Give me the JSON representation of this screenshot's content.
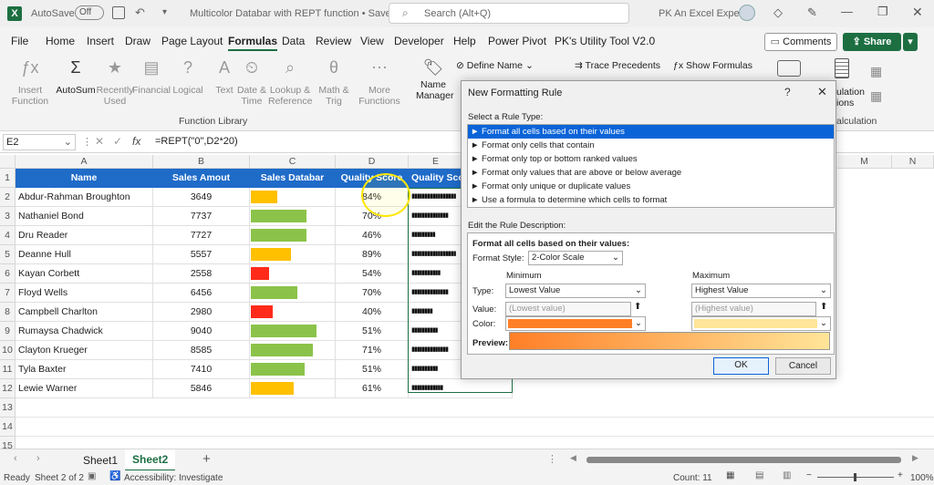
{
  "titlebar": {
    "autosave_label": "AutoSave",
    "autosave_state": "Off",
    "doc_title": "Multicolor Databar with REPT function • Saved",
    "search_placeholder": "Search (Alt+Q)",
    "user_name": "PK An Excel Expert"
  },
  "menu": {
    "items": [
      "File",
      "Home",
      "Insert",
      "Draw",
      "Page Layout",
      "Formulas",
      "Data",
      "Review",
      "View",
      "Developer",
      "Help",
      "Power Pivot",
      "PK's Utility Tool V2.0"
    ],
    "active": "Formulas",
    "comments_label": "Comments",
    "share_label": "Share"
  },
  "ribbon": {
    "buttons": [
      {
        "label": "Insert Function",
        "name": "insert-function"
      },
      {
        "label": "AutoSum",
        "name": "autosum"
      },
      {
        "label": "Recently Used",
        "name": "recently-used"
      },
      {
        "label": "Financial",
        "name": "financial"
      },
      {
        "label": "Logical",
        "name": "logical"
      },
      {
        "label": "Text",
        "name": "text"
      },
      {
        "label": "Date & Time",
        "name": "date-time"
      },
      {
        "label": "Lookup & Reference",
        "name": "lookup-reference"
      },
      {
        "label": "Math & Trig",
        "name": "math-trig"
      },
      {
        "label": "More Functions",
        "name": "more-functions"
      }
    ],
    "group_label": "Function Library",
    "name_manager": "Name Manager",
    "define_name": "Define Name",
    "trace_precedents": "Trace Precedents",
    "show_formulas": "Show Formulas",
    "calc_options": "ulation ions",
    "calc_group": "alculation"
  },
  "formula_bar": {
    "name_box": "E2",
    "fx": "fx",
    "formula": "=REPT(\"0\",D2*20)"
  },
  "grid": {
    "columns": [
      "A",
      "B",
      "C",
      "D",
      "E",
      "M",
      "N"
    ],
    "rows": [
      "1",
      "2",
      "3",
      "4",
      "5",
      "6",
      "7",
      "8",
      "9",
      "10",
      "11",
      "12",
      "13",
      "14",
      "15"
    ],
    "headers": [
      "Name",
      "Sales Amout",
      "Sales Databar",
      "Quality Score",
      "Quality Sco"
    ],
    "data": [
      {
        "name": "Abdur-Rahman Broughton",
        "sales": "3649",
        "bar": 0.4,
        "color": "#ffc000",
        "score": "84%",
        "rept": "▮▮▮▮▮▮▮▮▮▮▮▮▮▮▮▮▮"
      },
      {
        "name": "Nathaniel Bond",
        "sales": "7737",
        "bar": 0.85,
        "color": "#8bc34a",
        "score": "70%",
        "rept": "▮▮▮▮▮▮▮▮▮▮▮▮▮▮"
      },
      {
        "name": "Dru Reader",
        "sales": "7727",
        "bar": 0.85,
        "color": "#8bc34a",
        "score": "46%",
        "rept": "▮▮▮▮▮▮▮▮▮"
      },
      {
        "name": "Deanne Hull",
        "sales": "5557",
        "bar": 0.61,
        "color": "#ffc000",
        "score": "89%",
        "rept": "▮▮▮▮▮▮▮▮▮▮▮▮▮▮▮▮▮"
      },
      {
        "name": "Kayan Corbett",
        "sales": "2558",
        "bar": 0.28,
        "color": "#ff2a1a",
        "score": "54%",
        "rept": "▮▮▮▮▮▮▮▮▮▮▮"
      },
      {
        "name": "Floyd Wells",
        "sales": "6456",
        "bar": 0.71,
        "color": "#8bc34a",
        "score": "70%",
        "rept": "▮▮▮▮▮▮▮▮▮▮▮▮▮▮"
      },
      {
        "name": "Campbell Charlton",
        "sales": "2980",
        "bar": 0.33,
        "color": "#ff2a1a",
        "score": "40%",
        "rept": "▮▮▮▮▮▮▮▮"
      },
      {
        "name": "Rumaysa Chadwick",
        "sales": "9040",
        "bar": 1.0,
        "color": "#8bc34a",
        "score": "51%",
        "rept": "▮▮▮▮▮▮▮▮▮▮"
      },
      {
        "name": "Clayton Krueger",
        "sales": "8585",
        "bar": 0.95,
        "color": "#8bc34a",
        "score": "71%",
        "rept": "▮▮▮▮▮▮▮▮▮▮▮▮▮▮"
      },
      {
        "name": "Tyla Baxter",
        "sales": "7410",
        "bar": 0.82,
        "color": "#8bc34a",
        "score": "51%",
        "rept": "▮▮▮▮▮▮▮▮▮▮"
      },
      {
        "name": "Lewie Warner",
        "sales": "5846",
        "bar": 0.65,
        "color": "#ffc000",
        "score": "61%",
        "rept": "▮▮▮▮▮▮▮▮▮▮▮▮"
      }
    ]
  },
  "sheets": {
    "tabs": [
      "Sheet1",
      "Sheet2"
    ],
    "active": "Sheet2"
  },
  "status": {
    "ready": "Ready",
    "sheet_of": "Sheet 2 of 2",
    "accessibility": "Accessibility: Investigate",
    "count": "Count: 11",
    "zoom": "100%"
  },
  "dialog": {
    "title": "New Formatting Rule",
    "help": "?",
    "select_label": "Select a Rule Type:",
    "rules": [
      "► Format all cells based on their values",
      "► Format only cells that contain",
      "► Format only top or bottom ranked values",
      "► Format only values that are above or below average",
      "► Format only unique or duplicate values",
      "► Use a formula to determine which cells to format"
    ],
    "edit_label": "Edit the Rule Description:",
    "desc_title": "Format all cells based on their values:",
    "format_style_label": "Format Style:",
    "format_style": "2-Color Scale",
    "min_label": "Minimum",
    "max_label": "Maximum",
    "type_label": "Type:",
    "value_label": "Value:",
    "color_label": "Color:",
    "min_type": "Lowest Value",
    "max_type": "Highest Value",
    "min_value": "(Lowest value)",
    "max_value": "(Highest value)",
    "min_color": "#ff7f27",
    "max_color": "#ffe599",
    "preview_label": "Preview:",
    "ok": "OK",
    "cancel": "Cancel"
  }
}
